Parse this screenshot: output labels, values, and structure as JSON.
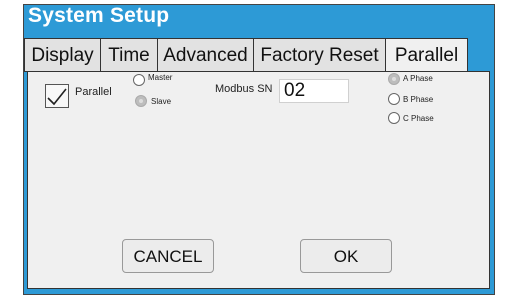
{
  "window": {
    "title": "System Setup"
  },
  "tabs": [
    {
      "label": "Display"
    },
    {
      "label": "Time"
    },
    {
      "label": "Advanced"
    },
    {
      "label": "Factory Reset"
    },
    {
      "label": "Parallel",
      "active": true
    }
  ],
  "parallel": {
    "enable": {
      "label": "Parallel",
      "checked": true
    },
    "role": {
      "options": [
        {
          "label": "Master",
          "selected": false
        },
        {
          "label": "Slave",
          "selected": true
        }
      ]
    },
    "modbus_sn": {
      "label": "Modbus SN",
      "value": "02"
    },
    "phase": {
      "options": [
        {
          "label": "A Phase",
          "selected": true
        },
        {
          "label": "B Phase",
          "selected": false
        },
        {
          "label": "C Phase",
          "selected": false
        }
      ]
    }
  },
  "buttons": {
    "cancel": "CANCEL",
    "ok": "OK"
  },
  "colors": {
    "header_blue": "#2d9ad6",
    "panel": "#f0f0f0",
    "tab": "#e2e2e2"
  }
}
